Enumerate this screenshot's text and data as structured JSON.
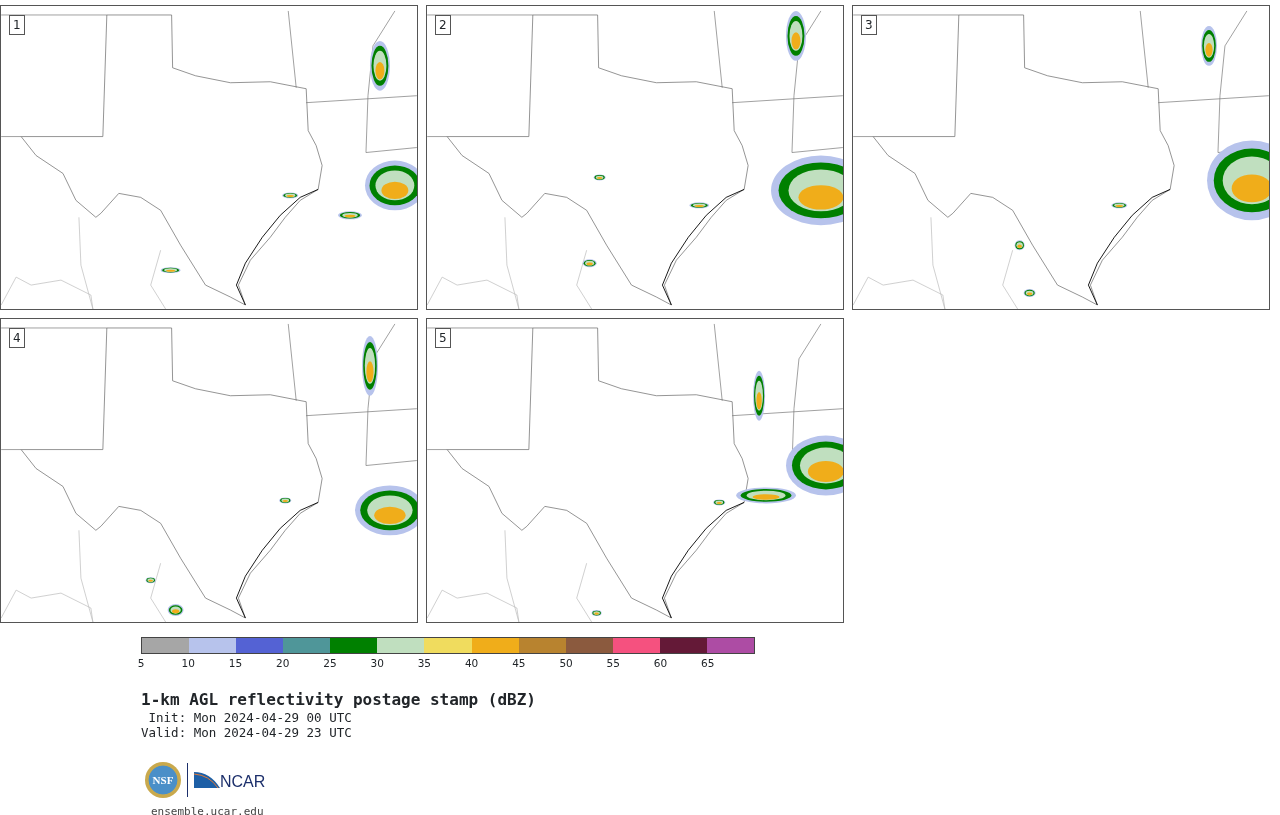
{
  "members": [
    {
      "label": "1"
    },
    {
      "label": "2"
    },
    {
      "label": "3"
    },
    {
      "label": "4"
    },
    {
      "label": "5"
    }
  ],
  "colorbar": {
    "bins": [
      {
        "color": "#a6a6a6"
      },
      {
        "color": "#b7c3ec"
      },
      {
        "color": "#5462d4"
      },
      {
        "color": "#4f9699"
      },
      {
        "color": "#008000"
      },
      {
        "color": "#c0dfbf"
      },
      {
        "color": "#f0dc5e"
      },
      {
        "color": "#f0ad1a"
      },
      {
        "color": "#b8832f"
      },
      {
        "color": "#8b5a3e"
      },
      {
        "color": "#f5517f"
      },
      {
        "color": "#641937"
      },
      {
        "color": "#ad4ca4"
      }
    ],
    "ticks": [
      "5",
      "10",
      "15",
      "20",
      "25",
      "30",
      "35",
      "40",
      "45",
      "50",
      "55",
      "60",
      "65"
    ]
  },
  "title": "1-km AGL reflectivity postage stamp (dBZ)",
  "init": " Init: Mon 2024-04-29 00 UTC",
  "valid": "Valid: Mon 2024-04-29 23 UTC",
  "logos": {
    "nsf": "NSF",
    "ncar": "NCAR"
  },
  "url": "ensemble.ucar.edu"
}
